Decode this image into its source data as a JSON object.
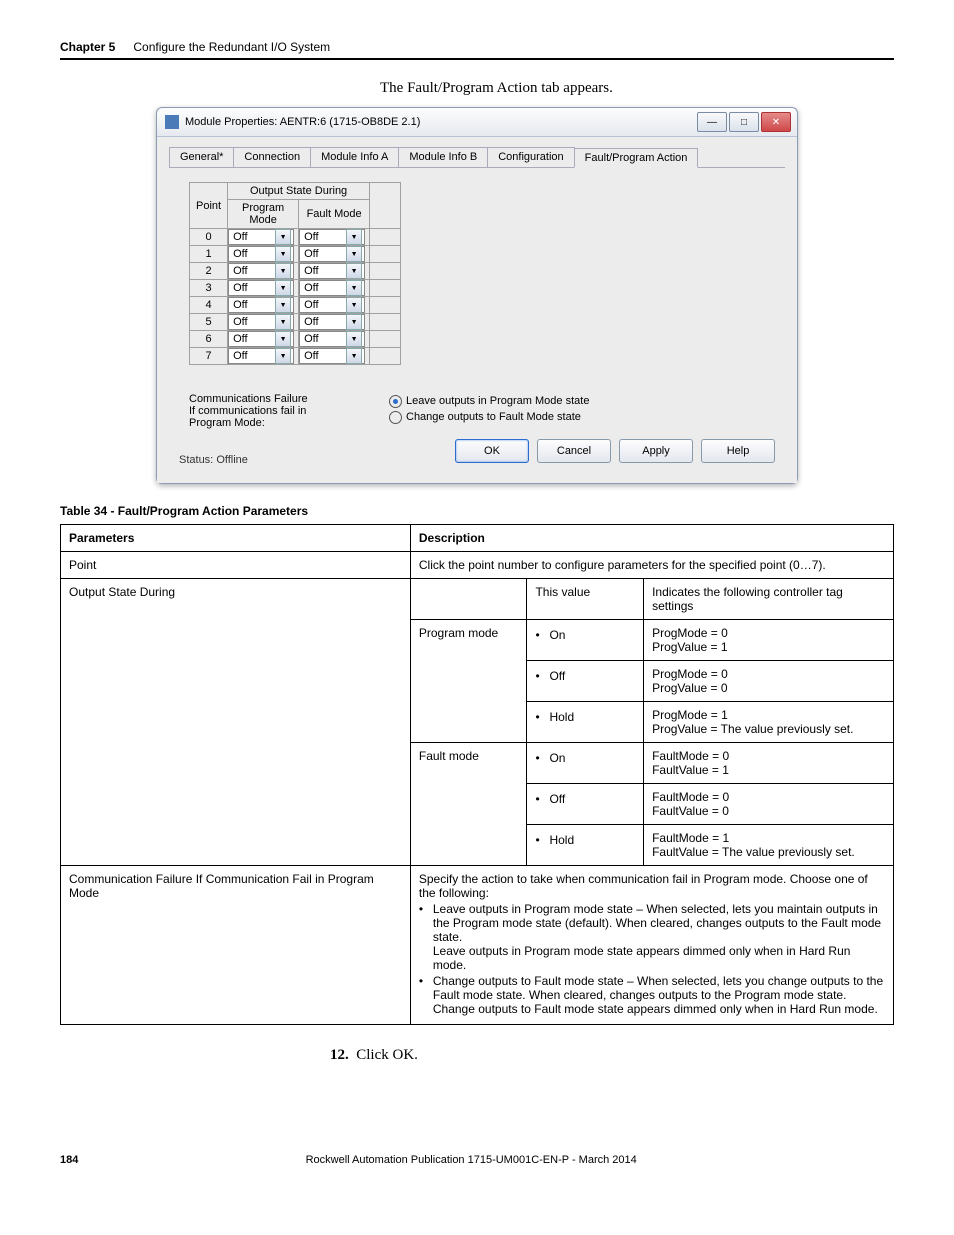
{
  "header": {
    "chapter": "Chapter 5",
    "title": "Configure the Redundant I/O System"
  },
  "intro": "The Fault/Program Action tab appears.",
  "dialog": {
    "title": "Module Properties: AENTR:6 (1715-OB8DE 2.1)",
    "tabs": [
      "General*",
      "Connection",
      "Module Info A",
      "Module Info B",
      "Configuration",
      "Fault/Program Action"
    ],
    "activeTabIndex": 5,
    "colHeaders": {
      "point": "Point",
      "group": "Output State During",
      "program": "Program Mode",
      "fault": "Fault Mode"
    },
    "rows": [
      {
        "pt": "0",
        "pm": "Off",
        "fm": "Off"
      },
      {
        "pt": "1",
        "pm": "Off",
        "fm": "Off"
      },
      {
        "pt": "2",
        "pm": "Off",
        "fm": "Off"
      },
      {
        "pt": "3",
        "pm": "Off",
        "fm": "Off"
      },
      {
        "pt": "4",
        "pm": "Off",
        "fm": "Off"
      },
      {
        "pt": "5",
        "pm": "Off",
        "fm": "Off"
      },
      {
        "pt": "6",
        "pm": "Off",
        "fm": "Off"
      },
      {
        "pt": "7",
        "pm": "Off",
        "fm": "Off"
      }
    ],
    "comm": {
      "heading": "Communications Failure",
      "subline1": "If communications fail in",
      "subline2": "Program Mode:",
      "opt1": "Leave outputs in Program Mode state",
      "opt2": "Change outputs to Fault Mode state"
    },
    "statusLabel": "Status:",
    "statusValue": "Offline",
    "buttons": {
      "ok": "OK",
      "cancel": "Cancel",
      "apply": "Apply",
      "help": "Help"
    }
  },
  "paramTable": {
    "caption": "Table 34 - Fault/Program Action Parameters",
    "head": {
      "c1": "Parameters",
      "c2": "Description"
    },
    "rowPoint": {
      "param": "Point",
      "desc": "Click the point number to configure parameters for the specified point (0…7)."
    },
    "rowOSD": {
      "param": "Output State During",
      "subhead": {
        "c1": "",
        "c2": "This value",
        "c3": "Indicates the following controller tag settings"
      },
      "programLabel": "Program mode",
      "faultLabel": "Fault mode",
      "vals": {
        "on": "On",
        "off": "Off",
        "hold": "Hold"
      },
      "progOn": "ProgMode = 0\nProgValue = 1",
      "progOff": "ProgMode = 0\nProgValue = 0",
      "progHold": "ProgMode = 1\nProgValue = The value previously set.",
      "fltOn": "FaultMode = 0\nFaultValue = 1",
      "fltOff": "FaultMode = 0\nFaultValue = 0",
      "fltHold": "FaultMode = 1\nFaultValue = The value previously set."
    },
    "rowComm": {
      "param": "Communication Failure If Communication Fail in Program Mode",
      "descIntro": "Specify the action to take when communication fail in Program mode. Choose one of the following:",
      "b1": "Leave outputs in Program mode state – When selected, lets you maintain outputs in the Program mode state (default). When cleared, changes outputs to the Fault mode state.\nLeave outputs in Program mode state appears dimmed only when in Hard Run mode.",
      "b2": "Change outputs to Fault mode state – When selected, lets you change outputs to the Fault mode state. When cleared, changes outputs to the Program mode state.\nChange outputs to Fault mode state appears dimmed only when in Hard Run mode."
    }
  },
  "step": {
    "num": "12.",
    "text": "Click OK."
  },
  "footer": {
    "page": "184",
    "pub": "Rockwell Automation Publication 1715-UM001C-EN-P - March 2014"
  }
}
